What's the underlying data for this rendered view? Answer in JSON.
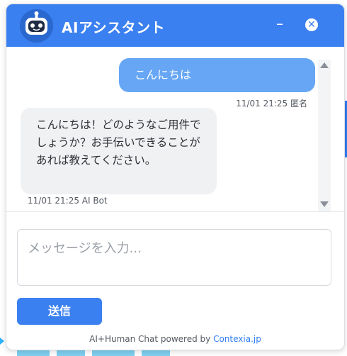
{
  "header": {
    "title": "AIアシスタント",
    "minimize_label": "–",
    "close_label": "✕"
  },
  "messages": [
    {
      "sender": "user",
      "text": "こんにちは",
      "meta": "11/01 21:25 匿名"
    },
    {
      "sender": "bot",
      "text": "こんにちは！どのようなご用件でしょうか？お手伝いできることがあれば教えてください。",
      "meta": "11/01 21:25 AI Bot"
    }
  ],
  "input": {
    "placeholder": "メッセージを入力..."
  },
  "send": {
    "label": "送信"
  },
  "footer": {
    "prefix": "AI+Human Chat powered by ",
    "link_text": "Contexia.jp"
  },
  "colors": {
    "accent": "#3b80f0",
    "user_bubble": "#66a6f5",
    "bot_bubble": "#f0f1f3"
  }
}
